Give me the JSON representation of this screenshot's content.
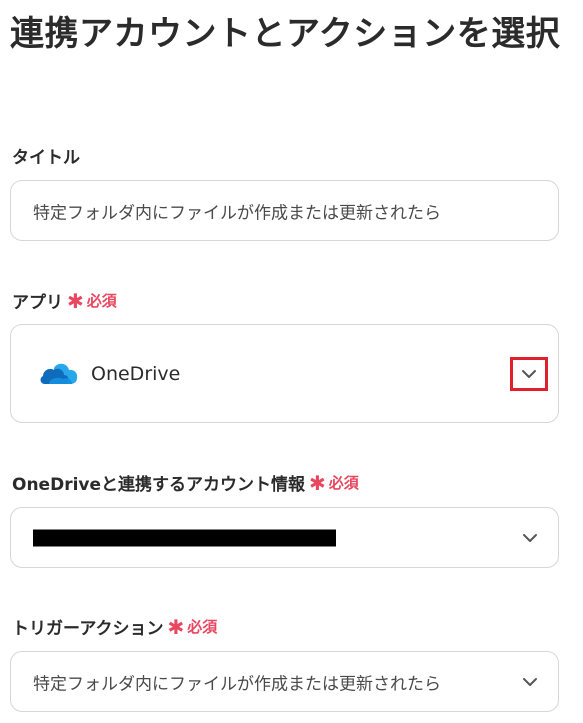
{
  "page": {
    "title": "連携アカウントとアクションを選択"
  },
  "required_label": "必須",
  "required_star": "✱",
  "fields": {
    "title": {
      "label": "タイトル",
      "value": "特定フォルダ内にファイルが作成または更新されたら"
    },
    "app": {
      "label": "アプリ",
      "value": "OneDrive",
      "icon": "onedrive-cloud-icon"
    },
    "account": {
      "label": "OneDriveと連携するアカウント情報",
      "value_redacted": true
    },
    "trigger": {
      "label": "トリガーアクション",
      "value": "特定フォルダ内にファイルが作成または更新されたら"
    }
  },
  "colors": {
    "required": "#e8475f",
    "highlight": "#e0202a",
    "border": "#d6d6d6",
    "onedrive_dark": "#0f6cbd",
    "onedrive_light": "#28a8ea"
  }
}
